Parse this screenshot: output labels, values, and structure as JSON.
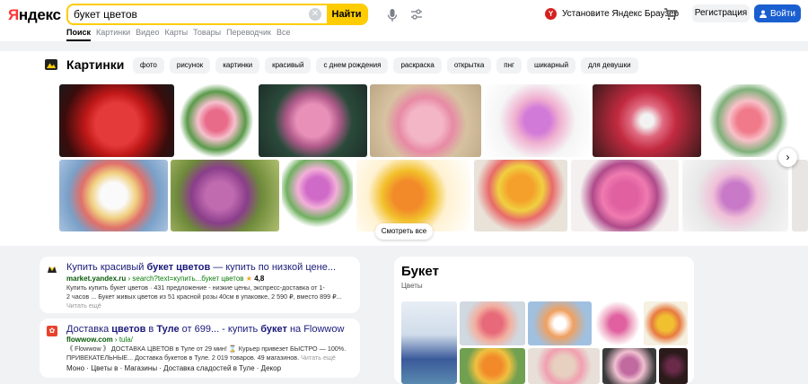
{
  "header": {
    "logo": "Яндекс",
    "search_value": "букет цветов",
    "search_button": "Найти",
    "browser_promo": "Установите Яндекс Браузер",
    "register_button": "Регистрация",
    "login_button": "Войти",
    "nav": [
      "Поиск",
      "Картинки",
      "Видео",
      "Карты",
      "Товары",
      "Переводчик",
      "Все"
    ]
  },
  "images": {
    "title": "Картинки",
    "tags": [
      "фото",
      "рисунок",
      "картинки",
      "красивый",
      "с днем рождения",
      "раскраска",
      "открытка",
      "пнг",
      "шикарный",
      "для девушки"
    ],
    "see_all": "Смотреть все"
  },
  "results": [
    {
      "title_pre": "Купить красивый ",
      "title_bold": "букет цветов",
      "title_post": " — купить по низкой цене...",
      "url_domain": "market.yandex.ru",
      "url_path": " › search?text=купить...букет цветов",
      "rating": "4,8",
      "snippet_line1": "Купить купить букет цветов · 431 предложение - низкие цены, экспресс-доставка от 1-",
      "snippet_line2": "2 часов ... Букет живых цветов из 51 красной розы 40см в упаковке, 2 590 ₽, вместо 899 ₽...",
      "more": "Читать ещё"
    },
    {
      "title_pre": "Доставка ",
      "title_bold": "цветов",
      "title_mid": " в ",
      "title_bold2": "Туле",
      "title_post": " от 699... - купить ",
      "title_bold3": "букет",
      "title_end": " на Flowwow",
      "url_domain": "flowwow.com",
      "url_path": " › tula/",
      "snippet_line1": "《 Flowwow 》 ДОСТАВКА ЦВЕТОВ в Туле от 29 мин! ⌛ Курьер привезет БЫСТРО — 100%.",
      "snippet_line2": "ПРИВЕКАТЕЛЬНЫЕ... Доставка букетов в Туле. 2 019 товаров. 49 магазинов.",
      "more": "Читать ещё",
      "sitelinks": [
        "Моно",
        "Цветы в",
        "Магазины",
        "Доставка сладостей в Туле",
        "Декор"
      ]
    }
  ],
  "knowledge_panel": {
    "title": "Букет",
    "subtitle": "Цветы"
  },
  "colors": {
    "accent_yellow": "#ffcc00",
    "login_blue": "#1a5fd0",
    "link_blue": "#1a1a7a",
    "url_green": "#0a7a0a"
  }
}
